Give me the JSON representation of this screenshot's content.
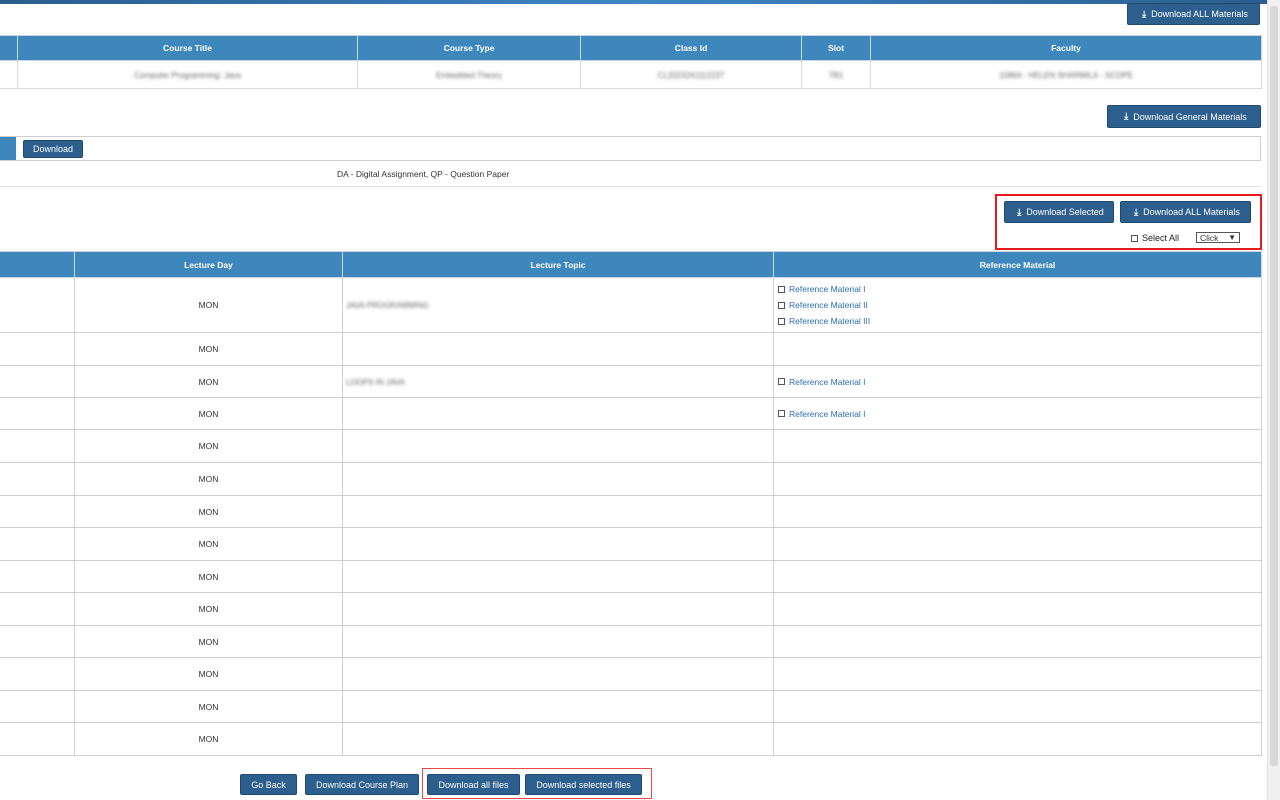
{
  "header": {
    "download_all_top": "Download ALL Materials"
  },
  "course_table": {
    "columns": [
      "",
      "Course Title",
      "Course Type",
      "Class Id",
      "Slot",
      "Faculty"
    ],
    "row": [
      "",
      "Computer Programming: Java",
      "Embedded Theory",
      "CL2023241112237",
      "TB1",
      "10864 - HELEN SHARMILA - SCOPE"
    ]
  },
  "general": {
    "download_general_label": "Download General Materials",
    "download_label": "Download",
    "legend": "DA - Digital Assignment, QP - Question Paper"
  },
  "material_actions": {
    "download_selected_label": "Download Selected",
    "download_all_label": "Download ALL Materials",
    "select_all_label": "Select All",
    "dropdown_value": "Click"
  },
  "lecture_table": {
    "columns": [
      "",
      "Lecture Day",
      "Lecture Topic",
      "Reference Material"
    ],
    "rows": [
      {
        "day": "MON",
        "topic": "JAVA PROGRAMMING",
        "refs": [
          "Reference Material I",
          "Reference Material II",
          "Reference Material III"
        ]
      },
      {
        "day": "MON",
        "topic": "",
        "refs": []
      },
      {
        "day": "MON",
        "topic": "LOOPS IN JAVA",
        "refs": [
          "Reference Material I"
        ]
      },
      {
        "day": "MON",
        "topic": "",
        "refs": [
          "Reference Material I"
        ]
      },
      {
        "day": "MON",
        "topic": "",
        "refs": []
      },
      {
        "day": "MON",
        "topic": "",
        "refs": []
      },
      {
        "day": "MON",
        "topic": "",
        "refs": []
      },
      {
        "day": "MON",
        "topic": "",
        "refs": []
      },
      {
        "day": "MON",
        "topic": "",
        "refs": []
      },
      {
        "day": "MON",
        "topic": "",
        "refs": []
      },
      {
        "day": "MON",
        "topic": "",
        "refs": []
      },
      {
        "day": "MON",
        "topic": "",
        "refs": []
      },
      {
        "day": "MON",
        "topic": "",
        "refs": []
      },
      {
        "day": "MON",
        "topic": "",
        "refs": []
      }
    ]
  },
  "footer": {
    "go_back": "Go Back",
    "download_course_plan": "Download Course Plan",
    "download_all_files": "Download all files",
    "download_selected_files": "Download selected files"
  },
  "colors": {
    "header_blue": "#3d87bd",
    "button_blue": "#2c5f8d",
    "highlight_red": "#e61b1b",
    "link_blue": "#2a6eb8"
  }
}
